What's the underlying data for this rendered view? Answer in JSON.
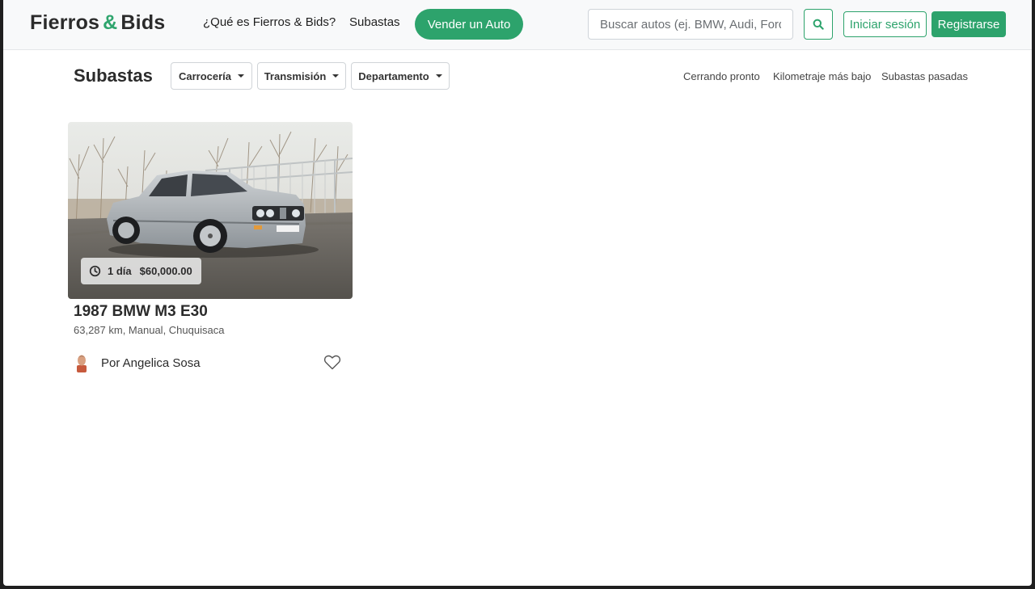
{
  "header": {
    "logo_part1": "Fierros",
    "logo_amp": "&",
    "logo_part2": "Bids",
    "nav_what": "¿Qué es Fierros & Bids?",
    "nav_auctions": "Subastas",
    "sell_button": "Vender un Auto",
    "search_placeholder": "Buscar autos (ej. BMW, Audi, Ford)",
    "login_button": "Iniciar sesión",
    "register_button": "Registrarse"
  },
  "filters": {
    "page_title": "Subastas",
    "dropdowns": [
      "Carrocería",
      "Transmisión",
      "Departamento"
    ],
    "sort_links": [
      "Cerrando pronto",
      "Kilometraje más bajo",
      "Subastas pasadas"
    ]
  },
  "listing": {
    "time_left": "1 día",
    "current_bid": "$60,000.00",
    "title": "1987 BMW M3 E30",
    "details": "63,287 km, Manual, Chuquisaca",
    "seller": "Por Angelica Sosa"
  },
  "colors": {
    "brand_green": "#2da36c",
    "header_bg": "#f8f9fa"
  },
  "icons": [
    "search-icon",
    "clock-icon",
    "heart-icon",
    "caret-down-icon"
  ]
}
